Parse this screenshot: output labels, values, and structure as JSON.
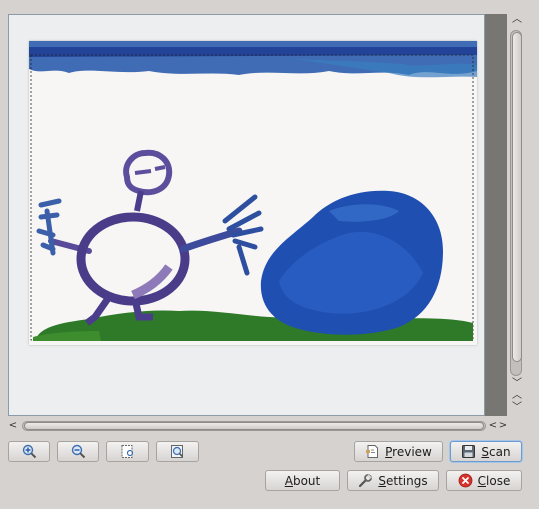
{
  "window": {
    "description_hidden": ""
  },
  "preview": {
    "image_icon": "scanned-drawing",
    "scrollbars": {
      "vertical_up": "︿",
      "vertical_down": "﹀",
      "left": "<",
      "right": ">"
    }
  },
  "toolbar": {
    "zoom_in_icon": "zoom-in-icon",
    "zoom_out_icon": "zoom-out-icon",
    "zoom_to_selection_icon": "zoom-selection-icon",
    "zoom_fit_icon": "zoom-fit-icon"
  },
  "buttons": {
    "preview": "Preview",
    "scan": "Scan",
    "about": "About",
    "settings": "Settings",
    "close": "Close"
  },
  "colors": {
    "accent_focus": "#6c9bd1",
    "close_icon": "#d8322d"
  }
}
